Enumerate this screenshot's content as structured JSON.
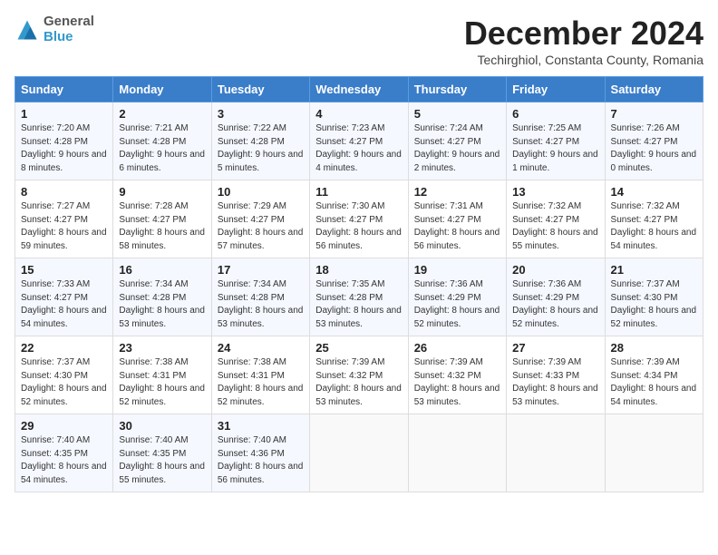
{
  "header": {
    "logo": {
      "general": "General",
      "blue": "Blue"
    },
    "month": "December 2024",
    "location": "Techirghiol, Constanta County, Romania"
  },
  "weekdays": [
    "Sunday",
    "Monday",
    "Tuesday",
    "Wednesday",
    "Thursday",
    "Friday",
    "Saturday"
  ],
  "weeks": [
    [
      {
        "day": "1",
        "sunrise": "Sunrise: 7:20 AM",
        "sunset": "Sunset: 4:28 PM",
        "daylight": "Daylight: 9 hours and 8 minutes."
      },
      {
        "day": "2",
        "sunrise": "Sunrise: 7:21 AM",
        "sunset": "Sunset: 4:28 PM",
        "daylight": "Daylight: 9 hours and 6 minutes."
      },
      {
        "day": "3",
        "sunrise": "Sunrise: 7:22 AM",
        "sunset": "Sunset: 4:28 PM",
        "daylight": "Daylight: 9 hours and 5 minutes."
      },
      {
        "day": "4",
        "sunrise": "Sunrise: 7:23 AM",
        "sunset": "Sunset: 4:27 PM",
        "daylight": "Daylight: 9 hours and 4 minutes."
      },
      {
        "day": "5",
        "sunrise": "Sunrise: 7:24 AM",
        "sunset": "Sunset: 4:27 PM",
        "daylight": "Daylight: 9 hours and 2 minutes."
      },
      {
        "day": "6",
        "sunrise": "Sunrise: 7:25 AM",
        "sunset": "Sunset: 4:27 PM",
        "daylight": "Daylight: 9 hours and 1 minute."
      },
      {
        "day": "7",
        "sunrise": "Sunrise: 7:26 AM",
        "sunset": "Sunset: 4:27 PM",
        "daylight": "Daylight: 9 hours and 0 minutes."
      }
    ],
    [
      {
        "day": "8",
        "sunrise": "Sunrise: 7:27 AM",
        "sunset": "Sunset: 4:27 PM",
        "daylight": "Daylight: 8 hours and 59 minutes."
      },
      {
        "day": "9",
        "sunrise": "Sunrise: 7:28 AM",
        "sunset": "Sunset: 4:27 PM",
        "daylight": "Daylight: 8 hours and 58 minutes."
      },
      {
        "day": "10",
        "sunrise": "Sunrise: 7:29 AM",
        "sunset": "Sunset: 4:27 PM",
        "daylight": "Daylight: 8 hours and 57 minutes."
      },
      {
        "day": "11",
        "sunrise": "Sunrise: 7:30 AM",
        "sunset": "Sunset: 4:27 PM",
        "daylight": "Daylight: 8 hours and 56 minutes."
      },
      {
        "day": "12",
        "sunrise": "Sunrise: 7:31 AM",
        "sunset": "Sunset: 4:27 PM",
        "daylight": "Daylight: 8 hours and 56 minutes."
      },
      {
        "day": "13",
        "sunrise": "Sunrise: 7:32 AM",
        "sunset": "Sunset: 4:27 PM",
        "daylight": "Daylight: 8 hours and 55 minutes."
      },
      {
        "day": "14",
        "sunrise": "Sunrise: 7:32 AM",
        "sunset": "Sunset: 4:27 PM",
        "daylight": "Daylight: 8 hours and 54 minutes."
      }
    ],
    [
      {
        "day": "15",
        "sunrise": "Sunrise: 7:33 AM",
        "sunset": "Sunset: 4:27 PM",
        "daylight": "Daylight: 8 hours and 54 minutes."
      },
      {
        "day": "16",
        "sunrise": "Sunrise: 7:34 AM",
        "sunset": "Sunset: 4:28 PM",
        "daylight": "Daylight: 8 hours and 53 minutes."
      },
      {
        "day": "17",
        "sunrise": "Sunrise: 7:34 AM",
        "sunset": "Sunset: 4:28 PM",
        "daylight": "Daylight: 8 hours and 53 minutes."
      },
      {
        "day": "18",
        "sunrise": "Sunrise: 7:35 AM",
        "sunset": "Sunset: 4:28 PM",
        "daylight": "Daylight: 8 hours and 53 minutes."
      },
      {
        "day": "19",
        "sunrise": "Sunrise: 7:36 AM",
        "sunset": "Sunset: 4:29 PM",
        "daylight": "Daylight: 8 hours and 52 minutes."
      },
      {
        "day": "20",
        "sunrise": "Sunrise: 7:36 AM",
        "sunset": "Sunset: 4:29 PM",
        "daylight": "Daylight: 8 hours and 52 minutes."
      },
      {
        "day": "21",
        "sunrise": "Sunrise: 7:37 AM",
        "sunset": "Sunset: 4:30 PM",
        "daylight": "Daylight: 8 hours and 52 minutes."
      }
    ],
    [
      {
        "day": "22",
        "sunrise": "Sunrise: 7:37 AM",
        "sunset": "Sunset: 4:30 PM",
        "daylight": "Daylight: 8 hours and 52 minutes."
      },
      {
        "day": "23",
        "sunrise": "Sunrise: 7:38 AM",
        "sunset": "Sunset: 4:31 PM",
        "daylight": "Daylight: 8 hours and 52 minutes."
      },
      {
        "day": "24",
        "sunrise": "Sunrise: 7:38 AM",
        "sunset": "Sunset: 4:31 PM",
        "daylight": "Daylight: 8 hours and 52 minutes."
      },
      {
        "day": "25",
        "sunrise": "Sunrise: 7:39 AM",
        "sunset": "Sunset: 4:32 PM",
        "daylight": "Daylight: 8 hours and 53 minutes."
      },
      {
        "day": "26",
        "sunrise": "Sunrise: 7:39 AM",
        "sunset": "Sunset: 4:32 PM",
        "daylight": "Daylight: 8 hours and 53 minutes."
      },
      {
        "day": "27",
        "sunrise": "Sunrise: 7:39 AM",
        "sunset": "Sunset: 4:33 PM",
        "daylight": "Daylight: 8 hours and 53 minutes."
      },
      {
        "day": "28",
        "sunrise": "Sunrise: 7:39 AM",
        "sunset": "Sunset: 4:34 PM",
        "daylight": "Daylight: 8 hours and 54 minutes."
      }
    ],
    [
      {
        "day": "29",
        "sunrise": "Sunrise: 7:40 AM",
        "sunset": "Sunset: 4:35 PM",
        "daylight": "Daylight: 8 hours and 54 minutes."
      },
      {
        "day": "30",
        "sunrise": "Sunrise: 7:40 AM",
        "sunset": "Sunset: 4:35 PM",
        "daylight": "Daylight: 8 hours and 55 minutes."
      },
      {
        "day": "31",
        "sunrise": "Sunrise: 7:40 AM",
        "sunset": "Sunset: 4:36 PM",
        "daylight": "Daylight: 8 hours and 56 minutes."
      },
      null,
      null,
      null,
      null
    ]
  ]
}
